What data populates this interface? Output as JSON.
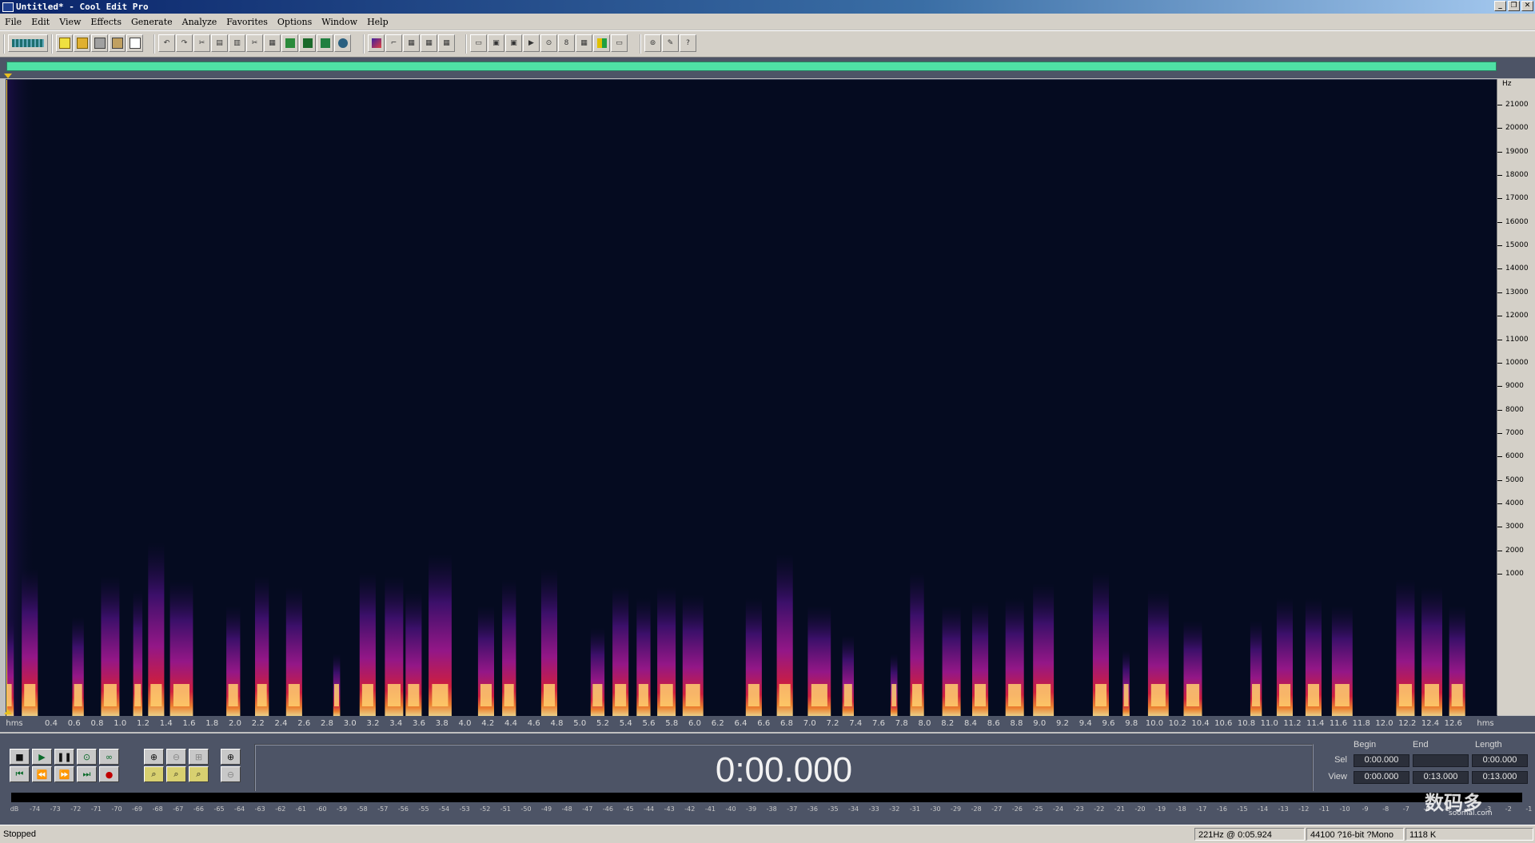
{
  "window": {
    "title": "Untitled* - Cool Edit Pro"
  },
  "menu": [
    "File",
    "Edit",
    "View",
    "Effects",
    "Generate",
    "Analyze",
    "Favorites",
    "Options",
    "Window",
    "Help"
  ],
  "hz_axis": {
    "unit": "Hz",
    "labels": [
      "21000",
      "20000",
      "19000",
      "18000",
      "17000",
      "16000",
      "15000",
      "14000",
      "13000",
      "12000",
      "11000",
      "10000",
      "9000",
      "8000",
      "7000",
      "6000",
      "5000",
      "4000",
      "3000",
      "2000",
      "1000"
    ]
  },
  "time_axis": {
    "start_label": "hms",
    "end_label": "hms",
    "labels": [
      "0.4",
      "0.6",
      "0.8",
      "1.0",
      "1.2",
      "1.4",
      "1.6",
      "1.8",
      "2.0",
      "2.2",
      "2.4",
      "2.6",
      "2.8",
      "3.0",
      "3.2",
      "3.4",
      "3.6",
      "3.8",
      "4.0",
      "4.2",
      "4.4",
      "4.6",
      "4.8",
      "5.0",
      "5.2",
      "5.4",
      "5.6",
      "5.8",
      "6.0",
      "6.2",
      "6.4",
      "6.6",
      "6.8",
      "7.0",
      "7.2",
      "7.4",
      "7.6",
      "7.8",
      "8.0",
      "8.2",
      "8.4",
      "8.6",
      "8.8",
      "9.0",
      "9.2",
      "9.4",
      "9.6",
      "9.8",
      "10.0",
      "10.2",
      "10.4",
      "10.6",
      "10.8",
      "11.0",
      "11.2",
      "11.4",
      "11.6",
      "11.8",
      "12.0",
      "12.2",
      "12.4",
      "12.6"
    ]
  },
  "time_display": "0:00.000",
  "selection": {
    "headers": {
      "begin": "Begin",
      "end": "End",
      "length": "Length"
    },
    "sel": {
      "label": "Sel",
      "begin": "0:00.000",
      "end": "",
      "length": "0:00.000"
    },
    "view": {
      "label": "View",
      "begin": "0:00.000",
      "end": "0:13.000",
      "length": "0:13.000"
    }
  },
  "level_labels": [
    "dB",
    "-74",
    "-73",
    "-72",
    "-71",
    "-70",
    "-69",
    "-68",
    "-67",
    "-66",
    "-65",
    "-64",
    "-63",
    "-62",
    "-61",
    "-60",
    "-59",
    "-58",
    "-57",
    "-56",
    "-55",
    "-54",
    "-53",
    "-52",
    "-51",
    "-50",
    "-49",
    "-48",
    "-47",
    "-46",
    "-45",
    "-44",
    "-43",
    "-42",
    "-41",
    "-40",
    "-39",
    "-38",
    "-37",
    "-36",
    "-35",
    "-34",
    "-33",
    "-32",
    "-31",
    "-30",
    "-29",
    "-28",
    "-27",
    "-26",
    "-25",
    "-24",
    "-23",
    "-22",
    "-21",
    "-20",
    "-19",
    "-18",
    "-17",
    "-16",
    "-15",
    "-14",
    "-13",
    "-12",
    "-11",
    "-10",
    "-9",
    "-8",
    "-7",
    "-6",
    "-5",
    "-4",
    "-3",
    "-2",
    "-1"
  ],
  "status": {
    "state": "Stopped",
    "cursor": "221Hz @  0:05.924",
    "format": "44100 ?16-bit ?Mono",
    "size": "1118 K"
  },
  "watermark": {
    "text": "数码多",
    "sub": "soomal.com"
  },
  "colors": {
    "overview_bar": "#4fe0a5",
    "spectrogram_bg": "#050b20",
    "panel_bg": "#4d5466"
  },
  "spectral_bursts": [
    {
      "t": 0.08,
      "w": 0.12,
      "h": 2500
    },
    {
      "t": 0.28,
      "w": 0.14,
      "h": 3800
    },
    {
      "t": 0.7,
      "w": 0.1,
      "h": 2500
    },
    {
      "t": 0.98,
      "w": 0.16,
      "h": 3600
    },
    {
      "t": 1.22,
      "w": 0.08,
      "h": 3200
    },
    {
      "t": 1.38,
      "w": 0.14,
      "h": 4500
    },
    {
      "t": 1.6,
      "w": 0.2,
      "h": 3500
    },
    {
      "t": 2.05,
      "w": 0.12,
      "h": 2800
    },
    {
      "t": 2.3,
      "w": 0.12,
      "h": 3600
    },
    {
      "t": 2.58,
      "w": 0.14,
      "h": 3300
    },
    {
      "t": 2.95,
      "w": 0.06,
      "h": 1500
    },
    {
      "t": 3.22,
      "w": 0.14,
      "h": 3700
    },
    {
      "t": 3.45,
      "w": 0.16,
      "h": 3600
    },
    {
      "t": 3.62,
      "w": 0.14,
      "h": 3200
    },
    {
      "t": 3.85,
      "w": 0.2,
      "h": 4200
    },
    {
      "t": 4.25,
      "w": 0.14,
      "h": 2800
    },
    {
      "t": 4.45,
      "w": 0.12,
      "h": 3500
    },
    {
      "t": 4.8,
      "w": 0.14,
      "h": 3800
    },
    {
      "t": 5.22,
      "w": 0.12,
      "h": 2200
    },
    {
      "t": 5.42,
      "w": 0.14,
      "h": 3300
    },
    {
      "t": 5.62,
      "w": 0.12,
      "h": 3000
    },
    {
      "t": 5.82,
      "w": 0.16,
      "h": 3300
    },
    {
      "t": 6.05,
      "w": 0.18,
      "h": 3100
    },
    {
      "t": 6.58,
      "w": 0.14,
      "h": 3000
    },
    {
      "t": 6.85,
      "w": 0.14,
      "h": 4200
    },
    {
      "t": 7.15,
      "w": 0.2,
      "h": 2800
    },
    {
      "t": 7.4,
      "w": 0.1,
      "h": 2000
    },
    {
      "t": 7.8,
      "w": 0.06,
      "h": 1500
    },
    {
      "t": 8.0,
      "w": 0.12,
      "h": 3700
    },
    {
      "t": 8.3,
      "w": 0.16,
      "h": 2800
    },
    {
      "t": 8.55,
      "w": 0.14,
      "h": 2900
    },
    {
      "t": 8.85,
      "w": 0.16,
      "h": 3000
    },
    {
      "t": 9.1,
      "w": 0.18,
      "h": 3400
    },
    {
      "t": 9.6,
      "w": 0.14,
      "h": 3700
    },
    {
      "t": 9.82,
      "w": 0.06,
      "h": 1600
    },
    {
      "t": 10.1,
      "w": 0.18,
      "h": 3200
    },
    {
      "t": 10.4,
      "w": 0.16,
      "h": 2400
    },
    {
      "t": 10.95,
      "w": 0.1,
      "h": 2400
    },
    {
      "t": 11.2,
      "w": 0.14,
      "h": 3000
    },
    {
      "t": 11.45,
      "w": 0.14,
      "h": 3000
    },
    {
      "t": 11.7,
      "w": 0.18,
      "h": 2800
    },
    {
      "t": 12.25,
      "w": 0.16,
      "h": 3500
    },
    {
      "t": 12.48,
      "w": 0.18,
      "h": 3300
    },
    {
      "t": 12.7,
      "w": 0.14,
      "h": 2800
    }
  ]
}
